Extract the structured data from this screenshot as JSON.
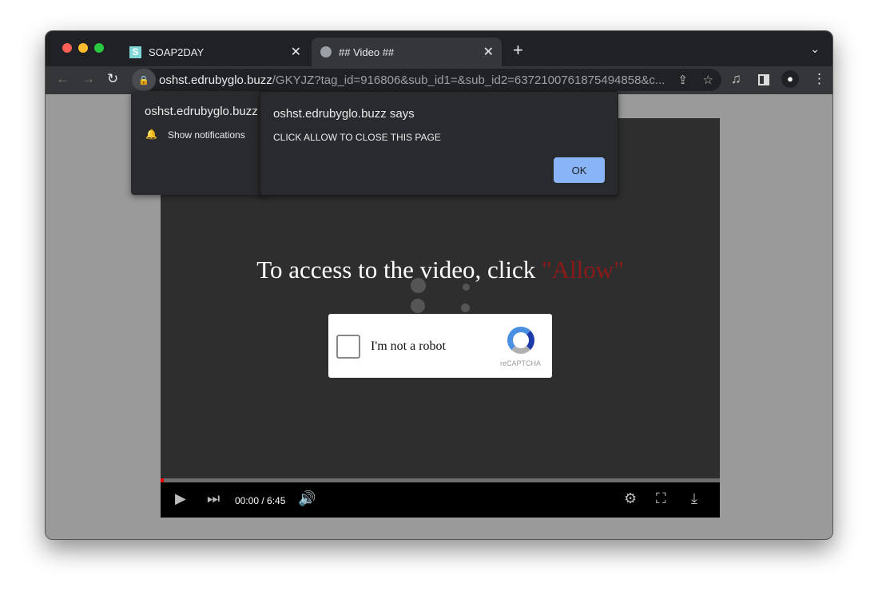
{
  "browser": {
    "tabs": [
      {
        "title": "SOAP2DAY",
        "favicon": "S",
        "active": false
      },
      {
        "title": "## Video ##",
        "favicon": "globe-icon",
        "active": true
      }
    ],
    "url_host": "oshst.edrubyglo.buzz",
    "url_path": "/GKYJZ?tag_id=916806&sub_id1=&sub_id2=6372100761875494858&c..."
  },
  "notification_prompt": {
    "site": "oshst.edrubyglo.buzz",
    "item": "Show notifications"
  },
  "dialog": {
    "title": "oshst.edrubyglo.buzz says",
    "message": "CLICK ALLOW TO CLOSE THIS PAGE",
    "ok_label": "OK"
  },
  "page": {
    "headline": "To access to the video, click ",
    "headline_highlight": "\"Allow\"",
    "captcha_label": "I'm not a robot",
    "captcha_brand": "reCAPTCHA"
  },
  "player": {
    "time": "00:00 / 6:45",
    "progress_percent": 0.5
  },
  "colors": {
    "accent_red": "#8b1a1a",
    "ok_button": "#8ab4f8"
  }
}
